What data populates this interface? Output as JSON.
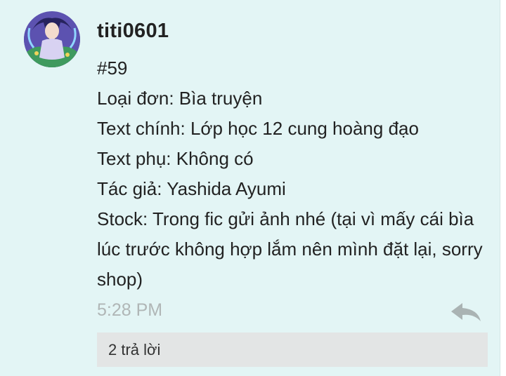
{
  "post": {
    "username": "titi0601",
    "number": "#59",
    "lines": [
      "Loại đơn: Bìa truyện",
      "Text chính: Lớp học 12 cung hoàng đạo",
      "Text phụ: Không có",
      "Tác giả: Yashida Ayumi",
      "Stock: Trong fic gửi ảnh nhé (tại vì mấy cái bìa lúc trước không hợp lắm nên mình đặt lại, sorry shop)"
    ],
    "time": "5:28 PM",
    "replies": "2 trả lời"
  },
  "icons": {
    "avatar": "user-avatar-anime-character",
    "reply": "reply-arrow-icon"
  },
  "colors": {
    "card_background": "#e3f5f5",
    "timestamp": "#b0b6b6",
    "reply_icon": "#aab3b3",
    "replies_bar": "#e3e5e5"
  }
}
